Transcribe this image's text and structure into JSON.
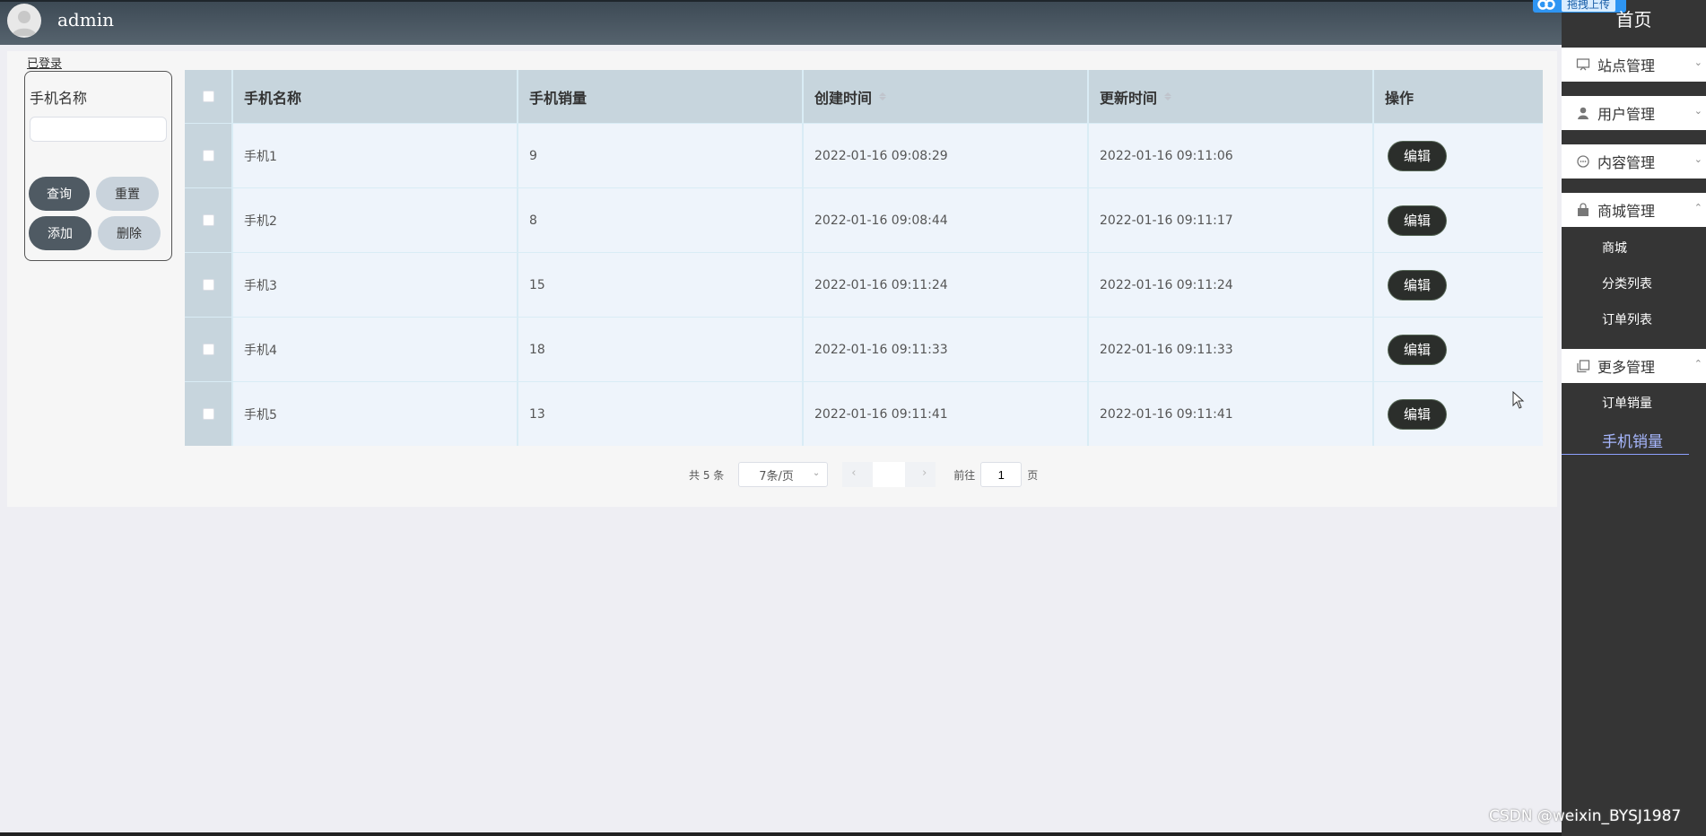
{
  "header": {
    "username": "admin"
  },
  "sidebar": {
    "home": "首页",
    "upload_badge": "拖拽上传",
    "groups": [
      {
        "label": "站点管理",
        "icon": "monitor-icon",
        "expanded": false
      },
      {
        "label": "用户管理",
        "icon": "user-icon",
        "expanded": false
      },
      {
        "label": "内容管理",
        "icon": "chat-icon",
        "expanded": false
      },
      {
        "label": "商城管理",
        "icon": "shopping-bag-icon",
        "expanded": true
      },
      {
        "label": "更多管理",
        "icon": "copy-icon",
        "expanded": true
      }
    ],
    "shop_items": [
      "商城",
      "分类列表",
      "订单列表"
    ],
    "more_items": [
      "订单销量",
      "手机销量"
    ],
    "active_item": "手机销量"
  },
  "panel": {
    "tag": "已登录"
  },
  "filter": {
    "label": "手机名称",
    "input_value": "",
    "query_label": "查询",
    "reset_label": "重置",
    "add_label": "添加",
    "delete_label": "删除"
  },
  "table": {
    "headers": {
      "name": "手机名称",
      "sales": "手机销量",
      "created": "创建时间",
      "updated": "更新时间",
      "op": "操作"
    },
    "edit_label": "编辑",
    "rows": [
      {
        "name": "手机1",
        "sales": "9",
        "created": "2022-01-16 09:08:29",
        "updated": "2022-01-16 09:11:06"
      },
      {
        "name": "手机2",
        "sales": "8",
        "created": "2022-01-16 09:08:44",
        "updated": "2022-01-16 09:11:17"
      },
      {
        "name": "手机3",
        "sales": "15",
        "created": "2022-01-16 09:11:24",
        "updated": "2022-01-16 09:11:24"
      },
      {
        "name": "手机4",
        "sales": "18",
        "created": "2022-01-16 09:11:33",
        "updated": "2022-01-16 09:11:33"
      },
      {
        "name": "手机5",
        "sales": "13",
        "created": "2022-01-16 09:11:41",
        "updated": "2022-01-16 09:11:41"
      }
    ]
  },
  "pagination": {
    "total": "共 5 条",
    "page_size": "7条/页",
    "goto_label": "前往",
    "current_page": "1",
    "page_suffix": "页"
  },
  "watermark": "CSDN @weixin_BYSJ1987",
  "colors": {
    "header_bg": "#4a5761",
    "sidebar_bg": "#353535",
    "table_header_bg": "#c7d5dd",
    "row_bg": "#eef4fb",
    "edit_button_bg": "#2b2e2b",
    "active_menu": "#a8b8ff"
  }
}
